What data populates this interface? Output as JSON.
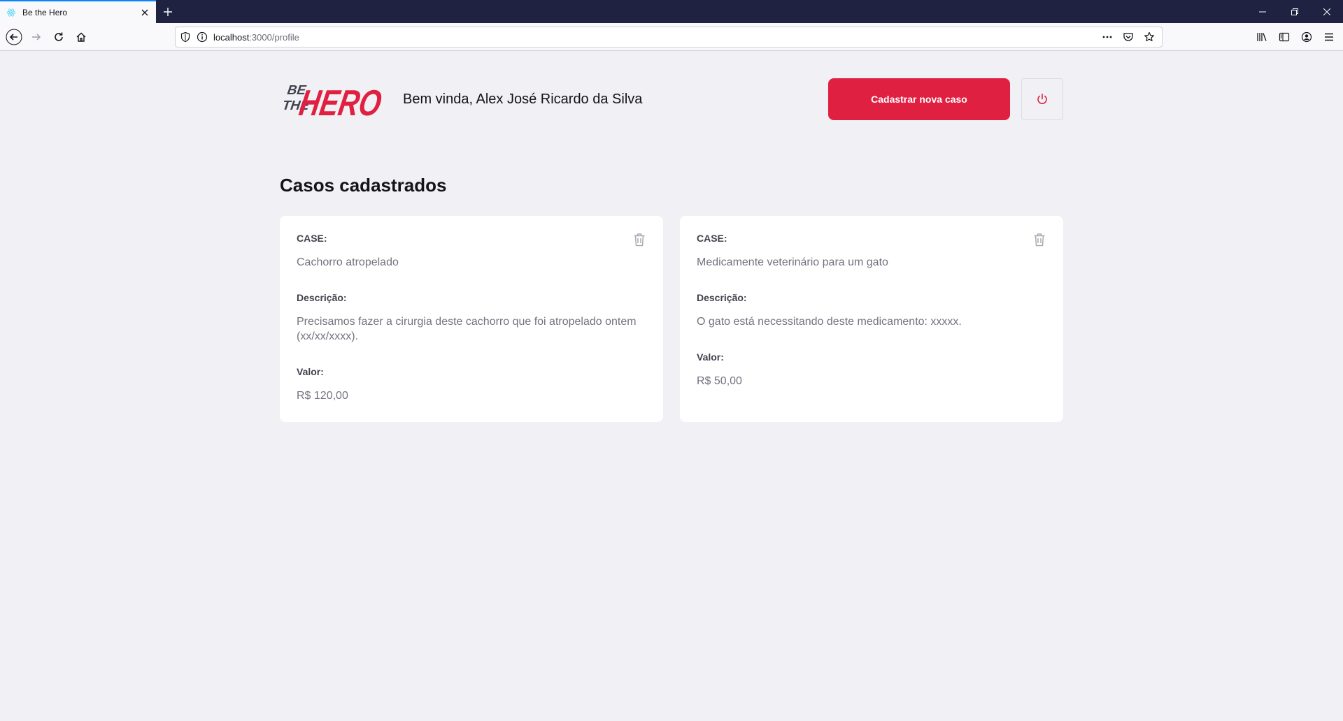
{
  "browser": {
    "tab_title": "Be the Hero",
    "url_host": "localhost",
    "url_path": ":3000/profile",
    "icons": {
      "favicon": "react-icon",
      "tab_close": "close-icon",
      "new_tab": "plus-icon",
      "back": "back-arrow-icon",
      "forward": "forward-arrow-icon",
      "reload": "reload-icon",
      "home": "home-icon",
      "shield": "shield-icon",
      "info": "info-icon",
      "more": "more-icon",
      "pocket": "pocket-icon",
      "bookmark": "star-icon",
      "library": "library-icon",
      "sidebar": "sidebar-icon",
      "account": "account-icon",
      "menu": "hamburger-menu-icon"
    }
  },
  "header": {
    "logo_text_be": "BE",
    "logo_text_the": "THE",
    "logo_text_hero": "HERO",
    "welcome": "Bem vinda, Alex José Ricardo da Silva",
    "new_case_button": "Cadastrar nova caso",
    "logout_icon": "power-icon"
  },
  "main": {
    "title": "Casos cadastrados",
    "cases": [
      {
        "case_label": "CASE:",
        "case_value": "Cachorro atropelado",
        "description_label": "Descrição:",
        "description_value": "Precisamos fazer a cirurgia deste cachorro que foi atropelado ontem (xx/xx/xxxx).",
        "value_label": "Valor:",
        "value_value": "R$ 120,00"
      },
      {
        "case_label": "CASE:",
        "case_value": "Medicamente veterinário para um gato",
        "description_label": "Descrição:",
        "description_value": "O gato está necessitando deste medicamento: xxxxx.",
        "value_label": "Valor:",
        "value_value": "R$ 50,00"
      }
    ]
  },
  "colors": {
    "brand_red": "#e02041",
    "background": "#f0f0f5",
    "chrome_dark": "#1f2240"
  }
}
